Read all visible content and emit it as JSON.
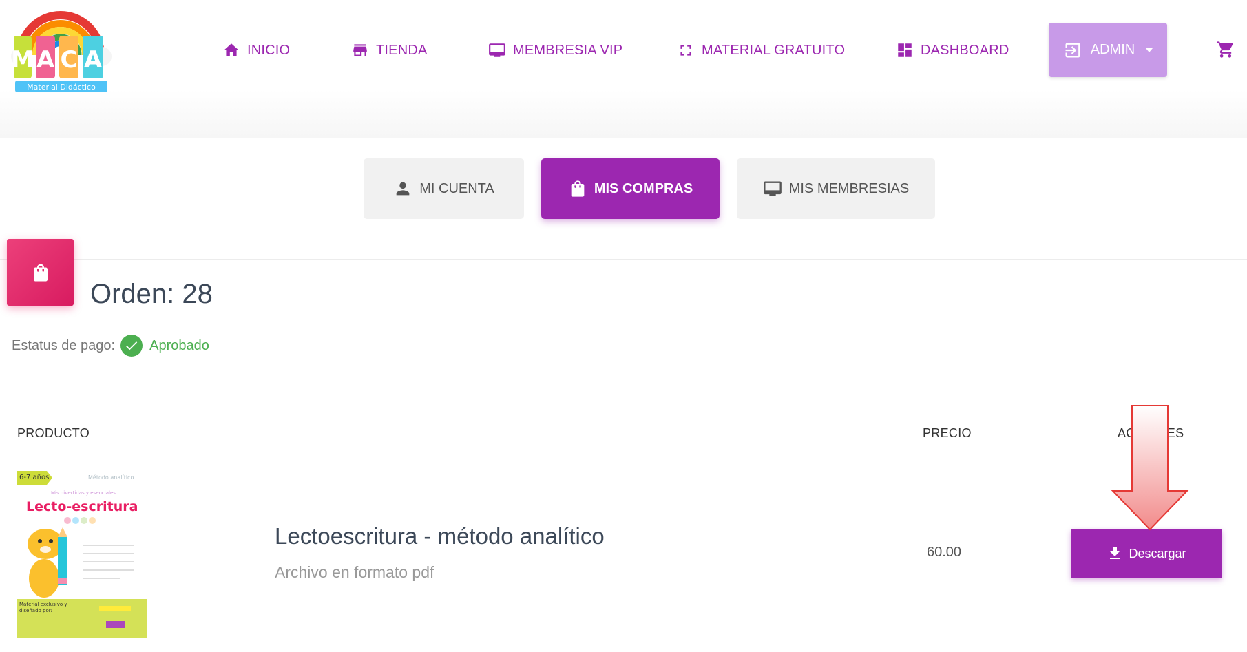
{
  "brand": {
    "logo_subtitle": "Material Didáctico",
    "logo_letters": "MACA"
  },
  "nav": {
    "items": [
      {
        "label": "INICIO",
        "icon": "home-icon"
      },
      {
        "label": "TIENDA",
        "icon": "store-icon"
      },
      {
        "label": "MEMBRESIA VIP",
        "icon": "monitor-icon"
      },
      {
        "label": "MATERIAL GRATUITO",
        "icon": "fullscreen-icon"
      },
      {
        "label": "DASHBOARD",
        "icon": "dashboard-icon"
      }
    ],
    "admin_label": "ADMIN",
    "cart_icon": "cart-icon"
  },
  "tabs": [
    {
      "label": "MI CUENTA",
      "icon": "person-icon",
      "active": false
    },
    {
      "label": "MIS COMPRAS",
      "icon": "shopping-bag-icon",
      "active": true
    },
    {
      "label": "MIS MEMBRESIAS",
      "icon": "monitor-icon",
      "active": false
    }
  ],
  "order": {
    "title": "Orden: 28",
    "status_label": "Estatus de pago:",
    "status_value": "Aprobado"
  },
  "table": {
    "headers": {
      "product": "PRODUCTO",
      "price": "PRECIO",
      "actions": "ACCIONES"
    },
    "rows": [
      {
        "name": "Lectoescritura - método analítico",
        "description": "Archivo en formato pdf",
        "price": "60.00",
        "action_label": "Descargar",
        "thumbnail": {
          "age": "6-7 años",
          "method": "Método analítico",
          "title": "Lecto-escritura",
          "subtitle": "Mis divertidas y esenciales",
          "footer": "Material exclusivo y diseñado por:"
        }
      }
    ]
  },
  "colors": {
    "primary": "#9c27b0",
    "admin_button": "#c89ae8",
    "order_icon": "#e91e63",
    "status_ok": "#4caf50",
    "arrow": "#f8a5a5"
  }
}
